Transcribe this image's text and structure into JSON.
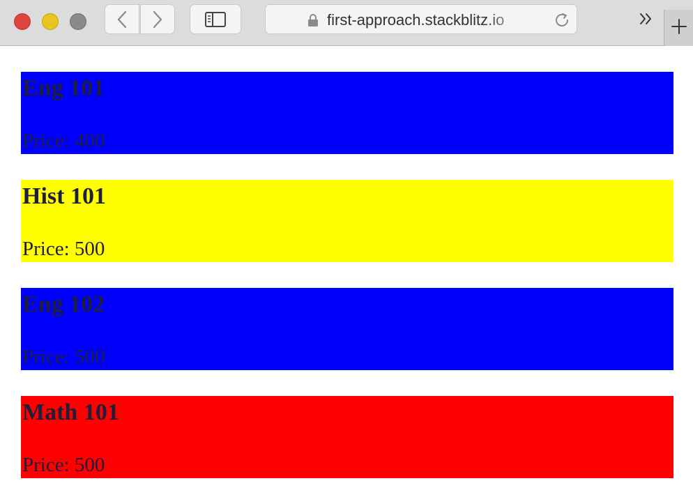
{
  "browser": {
    "url": "first-approach.stackblitz.io",
    "traffic_lights": {
      "close": "#e0443e",
      "minimize": "#e9c520",
      "maximize": "#8a8a8a"
    },
    "icons": [
      "back-icon",
      "forward-icon",
      "sidebar-icon",
      "lock-icon",
      "reload-icon",
      "chevrons-right-icon",
      "plus-icon"
    ]
  },
  "courses": [
    {
      "name": "Eng 101",
      "price_text": "Price: 400",
      "color": "#0000ff"
    },
    {
      "name": "Hist 101",
      "price_text": "Price: 500",
      "color": "#ffff00"
    },
    {
      "name": "Eng 102",
      "price_text": "Price: 500",
      "color": "#0000ff"
    },
    {
      "name": "Math 101",
      "price_text": "Price: 500",
      "color": "#ff0000"
    }
  ]
}
